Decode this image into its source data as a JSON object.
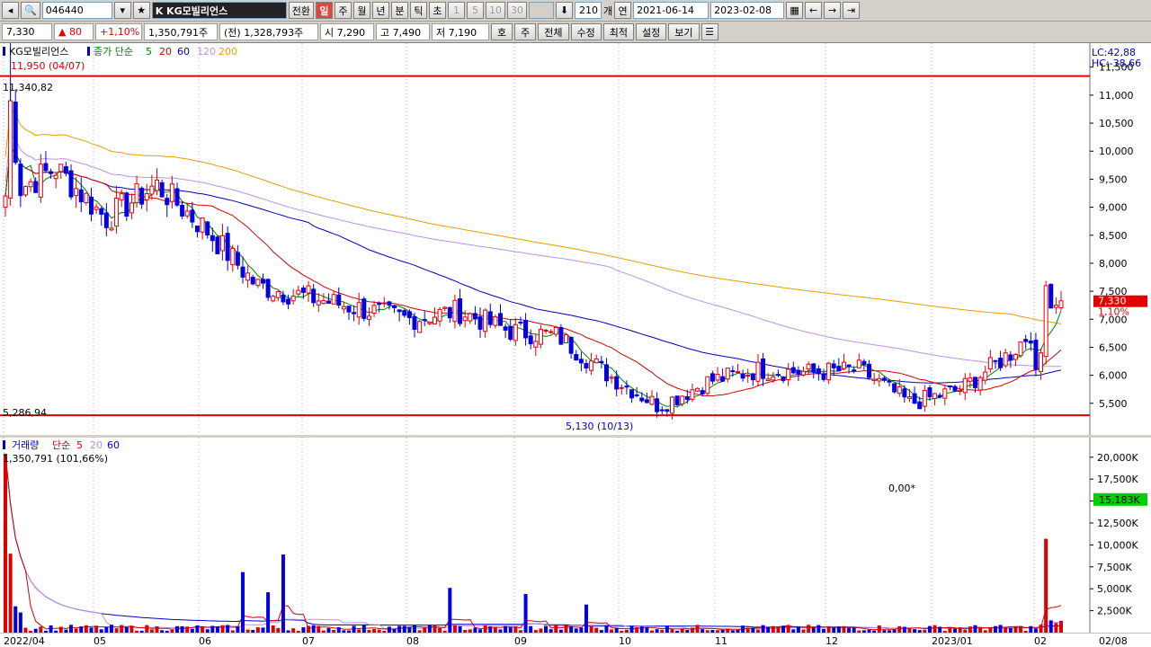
{
  "toolbar": {
    "code": "046440",
    "stock_name": "K  KG모빌리언스",
    "convert": "전환",
    "periods": [
      "일",
      "주",
      "월",
      "년",
      "분",
      "틱",
      "초"
    ],
    "minute_options": [
      "1",
      "5",
      "10",
      "30"
    ],
    "count": "210",
    "count_unit": "개",
    "year_label": "연",
    "start_date": "2021-06-14",
    "end_date": "2023-02-08"
  },
  "quote": {
    "price": "7,330",
    "change": "▲ 80",
    "change_pct": "+1,10%",
    "volume": "1,350,791주",
    "prev_volume": "(전) 1,328,793주",
    "open": "시 7,290",
    "high": "고 7,490",
    "low": "저 7,190",
    "menu": [
      "호",
      "주",
      "전체",
      "수정",
      "최적",
      "설정",
      "보기"
    ]
  },
  "price_legend": {
    "name": "KG모빌리언스",
    "label": "종가 단순",
    "periods": [
      {
        "p": "5",
        "color": "#008000"
      },
      {
        "p": "20",
        "color": "#d00000"
      },
      {
        "p": "60",
        "color": "#0000c0"
      },
      {
        "p": "120",
        "color": "#c090e0"
      },
      {
        "p": "200",
        "color": "#e0a000"
      }
    ]
  },
  "price_annotations": {
    "high_marker": "11,950 (04/07)",
    "upper_line_label": "11,340,82",
    "lower_line_label": "5,286,94",
    "low_marker": "5,130 (10/13)",
    "lc": "LC:42,88",
    "hc": "HC:-38,66",
    "current_tag": "7,330",
    "current_pct": "1,10%"
  },
  "price_axis": [
    "11,500",
    "11,000",
    "10,500",
    "10,000",
    "9,500",
    "9,000",
    "8,500",
    "8,000",
    "7,500",
    "7,000",
    "6,500",
    "6,000",
    "5,500"
  ],
  "volume_legend": {
    "label": "거래량",
    "sub": "단순",
    "periods": [
      {
        "p": "5",
        "color": "#d00000"
      },
      {
        "p": "20",
        "color": "#c090e0"
      },
      {
        "p": "60",
        "color": "#0000c0"
      }
    ],
    "value": "1,350,791 (101,66%)"
  },
  "volume_axis": [
    "20,000K",
    "17,500K",
    "15,000K",
    "12,500K",
    "10,000K",
    "7,500K",
    "5,000K",
    "2,500K"
  ],
  "volume_tag": "15,183K",
  "volume_note": "0,00*",
  "x_axis": [
    "2022/04",
    "05",
    "06",
    "07",
    "08",
    "09",
    "10",
    "11",
    "12",
    "2023/01",
    "02",
    "02/08"
  ],
  "colors": {
    "up": "#e00000",
    "down": "#0000e0",
    "ma5": "#008000",
    "ma20": "#d00000",
    "ma60": "#0000c0",
    "ma120": "#c090e0",
    "ma200": "#e0a000",
    "support_line": "#e00000"
  },
  "chart_data": {
    "type": "candlestick",
    "y_range": [
      5000,
      11800
    ],
    "horizontal_lines": [
      11340.82,
      5286.94
    ],
    "volume_y_range": [
      0,
      21000
    ],
    "months": [
      "2022/04",
      "05",
      "06",
      "07",
      "08",
      "09",
      "10",
      "11",
      "12",
      "2023/01",
      "02"
    ],
    "close_path": [
      [
        "2022/04",
        9200
      ],
      [
        "04-mid",
        9700
      ],
      [
        "05",
        8800
      ],
      [
        "05-mid",
        9400
      ],
      [
        "06",
        8600
      ],
      [
        "06-mid",
        7600
      ],
      [
        "07",
        7400
      ],
      [
        "07-mid",
        7200
      ],
      [
        "08",
        7000
      ],
      [
        "08-mid",
        7150
      ],
      [
        "09",
        6800
      ],
      [
        "09-mid",
        6700
      ],
      [
        "10",
        6000
      ],
      [
        "10-mid",
        5450
      ],
      [
        "11",
        5900
      ],
      [
        "11-mid",
        6100
      ],
      [
        "12",
        6050
      ],
      [
        "12-mid",
        6100
      ],
      [
        "2023/01",
        5500
      ],
      [
        "01-mid",
        5750
      ],
      [
        "02",
        6400
      ],
      [
        "02/08",
        7330
      ]
    ]
  }
}
